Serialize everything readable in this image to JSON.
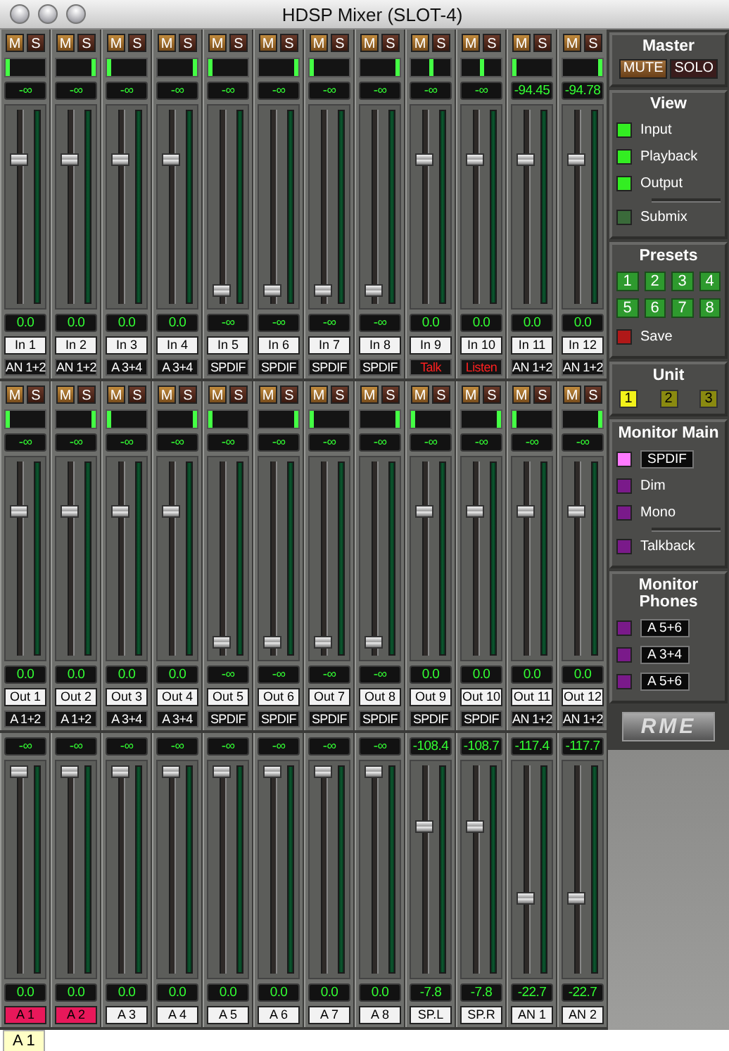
{
  "window": {
    "title": "HDSP Mixer (SLOT-4)"
  },
  "sections": [
    {
      "kind": "input",
      "strips": [
        {
          "m": "M",
          "s": "S",
          "pan": {
            "level": 0
          },
          "peak": "-∞",
          "level": 0.76,
          "gain": "0.0",
          "name": "In 1",
          "selected": false,
          "route": {
            "text": "AN 1+2",
            "highlighted": false
          }
        },
        {
          "m": "M",
          "s": "S",
          "pan": {
            "level": 1
          },
          "peak": "-∞",
          "level": 0.76,
          "gain": "0.0",
          "name": "In 2",
          "selected": false,
          "route": {
            "text": "AN 1+2",
            "highlighted": false
          }
        },
        {
          "m": "M",
          "s": "S",
          "pan": {
            "level": 0
          },
          "peak": "-∞",
          "level": 0.76,
          "gain": "0.0",
          "name": "In 3",
          "selected": false,
          "route": {
            "text": "A 3+4",
            "highlighted": false
          }
        },
        {
          "m": "M",
          "s": "S",
          "pan": {
            "level": 1
          },
          "peak": "-∞",
          "level": 0.76,
          "gain": "0.0",
          "name": "In 4",
          "selected": false,
          "route": {
            "text": "A 3+4",
            "highlighted": false
          }
        },
        {
          "m": "M",
          "s": "S",
          "pan": {
            "level": 0
          },
          "peak": "-∞",
          "level": 0.04,
          "gain": "-∞",
          "name": "In 5",
          "selected": false,
          "route": {
            "text": "SPDIF",
            "highlighted": false
          }
        },
        {
          "m": "M",
          "s": "S",
          "pan": {
            "level": 1
          },
          "peak": "-∞",
          "level": 0.04,
          "gain": "-∞",
          "name": "In 6",
          "selected": false,
          "route": {
            "text": "SPDIF",
            "highlighted": false
          }
        },
        {
          "m": "M",
          "s": "S",
          "pan": {
            "level": 0
          },
          "peak": "-∞",
          "level": 0.04,
          "gain": "-∞",
          "name": "In 7",
          "selected": false,
          "route": {
            "text": "SPDIF",
            "highlighted": false
          }
        },
        {
          "m": "M",
          "s": "S",
          "pan": {
            "level": 1
          },
          "peak": "-∞",
          "level": 0.04,
          "gain": "-∞",
          "name": "In 8",
          "selected": false,
          "route": {
            "text": "SPDIF",
            "highlighted": false
          }
        },
        {
          "m": "M",
          "s": "S",
          "pan": {
            "level": 0.5
          },
          "peak": "-∞",
          "level": 0.76,
          "gain": "0.0",
          "name": "In 9",
          "selected": false,
          "route": {
            "text": "Talk",
            "highlighted": true
          }
        },
        {
          "m": "M",
          "s": "S",
          "pan": {
            "level": 0.5
          },
          "peak": "-∞",
          "level": 0.76,
          "gain": "0.0",
          "name": "In 10",
          "selected": false,
          "route": {
            "text": "Listen",
            "highlighted": true
          }
        },
        {
          "m": "M",
          "s": "S",
          "pan": {
            "level": 0
          },
          "peak": "-94.45",
          "level": 0.76,
          "gain": "0.0",
          "name": "In 11",
          "selected": false,
          "route": {
            "text": "AN 1+2",
            "highlighted": false
          }
        },
        {
          "m": "M",
          "s": "S",
          "pan": {
            "level": 1
          },
          "peak": "-94.78",
          "level": 0.76,
          "gain": "0.0",
          "name": "In 12",
          "selected": false,
          "route": {
            "text": "AN 1+2",
            "highlighted": false
          }
        }
      ]
    },
    {
      "kind": "playback",
      "strips": [
        {
          "m": "M",
          "s": "S",
          "pan": {
            "level": 0
          },
          "peak": "-∞",
          "level": 0.76,
          "gain": "0.0",
          "name": "Out 1",
          "selected": false,
          "route": {
            "text": "A 1+2",
            "highlighted": false
          }
        },
        {
          "m": "M",
          "s": "S",
          "pan": {
            "level": 1
          },
          "peak": "-∞",
          "level": 0.76,
          "gain": "0.0",
          "name": "Out 2",
          "selected": false,
          "route": {
            "text": "A 1+2",
            "highlighted": false
          }
        },
        {
          "m": "M",
          "s": "S",
          "pan": {
            "level": 0
          },
          "peak": "-∞",
          "level": 0.76,
          "gain": "0.0",
          "name": "Out 3",
          "selected": false,
          "route": {
            "text": "A 3+4",
            "highlighted": false
          }
        },
        {
          "m": "M",
          "s": "S",
          "pan": {
            "level": 1
          },
          "peak": "-∞",
          "level": 0.76,
          "gain": "0.0",
          "name": "Out 4",
          "selected": false,
          "route": {
            "text": "A 3+4",
            "highlighted": false
          }
        },
        {
          "m": "M",
          "s": "S",
          "pan": {
            "level": 0
          },
          "peak": "-∞",
          "level": 0.04,
          "gain": "-∞",
          "name": "Out 5",
          "selected": false,
          "route": {
            "text": "SPDIF",
            "highlighted": false
          }
        },
        {
          "m": "M",
          "s": "S",
          "pan": {
            "level": 1
          },
          "peak": "-∞",
          "level": 0.04,
          "gain": "-∞",
          "name": "Out 6",
          "selected": false,
          "route": {
            "text": "SPDIF",
            "highlighted": false
          }
        },
        {
          "m": "M",
          "s": "S",
          "pan": {
            "level": 0
          },
          "peak": "-∞",
          "level": 0.04,
          "gain": "-∞",
          "name": "Out 7",
          "selected": false,
          "route": {
            "text": "SPDIF",
            "highlighted": false
          }
        },
        {
          "m": "M",
          "s": "S",
          "pan": {
            "level": 1
          },
          "peak": "-∞",
          "level": 0.04,
          "gain": "-∞",
          "name": "Out 8",
          "selected": false,
          "route": {
            "text": "SPDIF",
            "highlighted": false
          }
        },
        {
          "m": "M",
          "s": "S",
          "pan": {
            "level": 0
          },
          "peak": "-∞",
          "level": 0.76,
          "gain": "0.0",
          "name": "Out 9",
          "selected": false,
          "route": {
            "text": "SPDIF",
            "highlighted": false
          }
        },
        {
          "m": "M",
          "s": "S",
          "pan": {
            "level": 1
          },
          "peak": "-∞",
          "level": 0.76,
          "gain": "0.0",
          "name": "Out 10",
          "selected": false,
          "route": {
            "text": "SPDIF",
            "highlighted": false
          }
        },
        {
          "m": "M",
          "s": "S",
          "pan": {
            "level": 0
          },
          "peak": "-∞",
          "level": 0.76,
          "gain": "0.0",
          "name": "Out 11",
          "selected": false,
          "route": {
            "text": "AN 1+2",
            "highlighted": false
          }
        },
        {
          "m": "M",
          "s": "S",
          "pan": {
            "level": 1
          },
          "peak": "-∞",
          "level": 0.76,
          "gain": "0.0",
          "name": "Out 12",
          "selected": false,
          "route": {
            "text": "AN 1+2",
            "highlighted": false
          }
        }
      ]
    },
    {
      "kind": "output",
      "strips": [
        {
          "peak": "-∞",
          "level": 1,
          "gain": "0.0",
          "name": "A 1",
          "selected": true
        },
        {
          "peak": "-∞",
          "level": 1,
          "gain": "0.0",
          "name": "A 2",
          "selected": true
        },
        {
          "peak": "-∞",
          "level": 1,
          "gain": "0.0",
          "name": "A 3",
          "selected": false
        },
        {
          "peak": "-∞",
          "level": 1,
          "gain": "0.0",
          "name": "A 4",
          "selected": false
        },
        {
          "peak": "-∞",
          "level": 1,
          "gain": "0.0",
          "name": "A 5",
          "selected": false
        },
        {
          "peak": "-∞",
          "level": 1,
          "gain": "0.0",
          "name": "A 6",
          "selected": false
        },
        {
          "peak": "-∞",
          "level": 1,
          "gain": "0.0",
          "name": "A 7",
          "selected": false
        },
        {
          "peak": "-∞",
          "level": 1,
          "gain": "0.0",
          "name": "A 8",
          "selected": false
        },
        {
          "peak": "-108.4",
          "level": 0.72,
          "gain": "-7.8",
          "name": "SP.L",
          "selected": false
        },
        {
          "peak": "-108.7",
          "level": 0.72,
          "gain": "-7.8",
          "name": "SP.R",
          "selected": false
        },
        {
          "peak": "-117.4",
          "level": 0.35,
          "gain": "-22.7",
          "name": "AN 1",
          "selected": false
        },
        {
          "peak": "-117.7",
          "level": 0.35,
          "gain": "-22.7",
          "name": "AN 2",
          "selected": false
        }
      ]
    }
  ],
  "master": {
    "title": "Master",
    "mute": "MUTE",
    "solo": "SOLO"
  },
  "view": {
    "title": "View",
    "items": [
      {
        "label": "Input",
        "on": true
      },
      {
        "label": "Playback",
        "on": true
      },
      {
        "label": "Output",
        "on": true
      },
      {
        "label": "Submix",
        "on": false
      }
    ]
  },
  "presets": {
    "title": "Presets",
    "buttons": [
      "1",
      "2",
      "3",
      "4",
      "5",
      "6",
      "7",
      "8"
    ],
    "save": "Save"
  },
  "unit": {
    "title": "Unit",
    "items": [
      {
        "label": "1",
        "selected": true
      },
      {
        "label": "2",
        "selected": false
      },
      {
        "label": "3",
        "selected": false
      }
    ]
  },
  "monitor_main": {
    "title": "Monitor Main",
    "items": [
      {
        "kind": "select",
        "label": "SPDIF",
        "on": true
      },
      {
        "kind": "toggle",
        "label": "Dim",
        "on": false
      },
      {
        "kind": "toggle",
        "label": "Mono",
        "on": false
      },
      {
        "kind": "toggle",
        "label": "Talkback",
        "on": false
      }
    ]
  },
  "monitor_phones": {
    "title": "Monitor Phones",
    "items": [
      {
        "kind": "select",
        "label": "A 5+6",
        "on": false
      },
      {
        "kind": "select",
        "label": "A 3+4",
        "on": false
      },
      {
        "kind": "select",
        "label": "A 5+6",
        "on": false
      }
    ]
  },
  "logo": "RME",
  "tooltip": "A 1"
}
